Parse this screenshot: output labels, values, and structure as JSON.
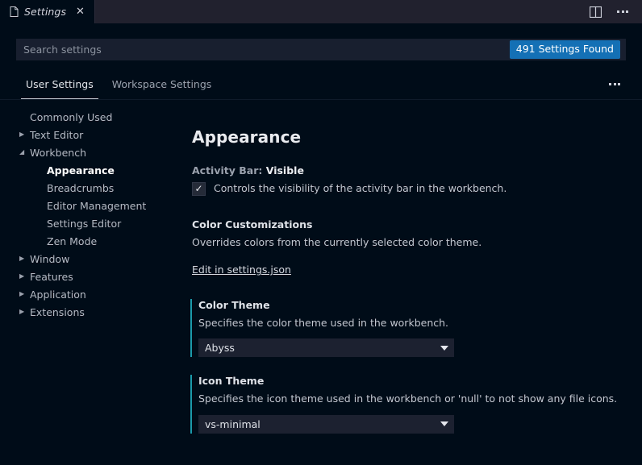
{
  "window": {
    "tab": {
      "label": "Settings",
      "file_icon": "file-icon",
      "close_icon": "close-icon"
    },
    "actions": {
      "split_editor": "split-editor-icon",
      "more": "more-actions-icon"
    }
  },
  "search": {
    "placeholder": "Search settings",
    "value": "",
    "results_badge": "491 Settings Found",
    "badge_color": "#1470b5"
  },
  "settings_tabs": {
    "items": [
      {
        "label": "User Settings",
        "active": true
      },
      {
        "label": "Workspace Settings",
        "active": false
      }
    ],
    "more_icon": "more-actions-icon"
  },
  "toc": {
    "items": [
      {
        "label": "Commonly Used",
        "level": 0,
        "twisty": "",
        "selected": false
      },
      {
        "label": "Text Editor",
        "level": 0,
        "twisty": "collapsed",
        "selected": false
      },
      {
        "label": "Workbench",
        "level": 0,
        "twisty": "expanded",
        "selected": false
      },
      {
        "label": "Appearance",
        "level": 1,
        "twisty": "",
        "selected": true
      },
      {
        "label": "Breadcrumbs",
        "level": 1,
        "twisty": "",
        "selected": false
      },
      {
        "label": "Editor Management",
        "level": 1,
        "twisty": "",
        "selected": false
      },
      {
        "label": "Settings Editor",
        "level": 1,
        "twisty": "",
        "selected": false
      },
      {
        "label": "Zen Mode",
        "level": 1,
        "twisty": "",
        "selected": false
      },
      {
        "label": "Window",
        "level": 0,
        "twisty": "collapsed",
        "selected": false
      },
      {
        "label": "Features",
        "level": 0,
        "twisty": "collapsed",
        "selected": false
      },
      {
        "label": "Application",
        "level": 0,
        "twisty": "collapsed",
        "selected": false
      },
      {
        "label": "Extensions",
        "level": 0,
        "twisty": "collapsed",
        "selected": false
      }
    ]
  },
  "main": {
    "heading": "Appearance",
    "accent_color": "#1b9aaa",
    "settings": {
      "activity_bar": {
        "key": "Activity Bar:",
        "value": "Visible",
        "description": "Controls the visibility of the activity bar in the workbench.",
        "checked": true,
        "check_glyph": "✓"
      },
      "color_customizations": {
        "title": "Color Customizations",
        "description": "Overrides colors from the currently selected color theme.",
        "link": "Edit in settings.json"
      },
      "color_theme": {
        "title": "Color Theme",
        "description": "Specifies the color theme used in the workbench.",
        "selected": "Abyss"
      },
      "icon_theme": {
        "title": "Icon Theme",
        "description": "Specifies the icon theme used in the workbench or 'null' to not show any file icons.",
        "selected": "vs-minimal"
      }
    }
  }
}
